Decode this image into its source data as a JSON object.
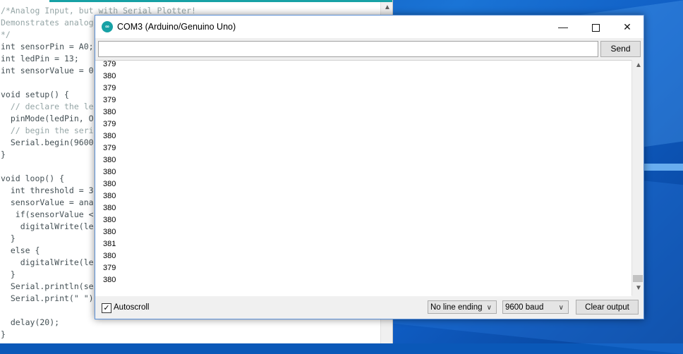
{
  "editor": {
    "code_lines": [
      "/*Analog Input, but with Serial Plotter!",
      "Demonstrates analog",
      "*/",
      "int sensorPin = A0;",
      "int ledPin = 13;",
      "int sensorValue = 0",
      "",
      "void setup() {",
      "  // declare the le",
      "  pinMode(ledPin, O",
      "  // begin the seri",
      "  Serial.begin(9600",
      "}",
      "",
      "void loop() {",
      "  int threshold = 3",
      "  sensorValue = ana",
      "   if(sensorValue <",
      "    digitalWrite(le",
      "  }",
      "  else {",
      "    digitalWrite(le",
      "  }",
      "  Serial.println(se",
      "  Serial.print(\" \")",
      "",
      "  delay(20);",
      "}"
    ]
  },
  "serial_monitor": {
    "title": "COM3 (Arduino/Genuino Uno)",
    "input_value": "",
    "send_label": "Send",
    "output_lines": [
      "379",
      "380",
      "379",
      "379",
      "380",
      "379",
      "380",
      "379",
      "380",
      "380",
      "380",
      "380",
      "380",
      "380",
      "380",
      "381",
      "380",
      "379",
      "380"
    ],
    "autoscroll_label": "Autoscroll",
    "autoscroll_checked": true,
    "line_ending": "No line ending",
    "baud_rate": "9600 baud",
    "clear_label": "Clear output"
  },
  "colors": {
    "arduino_teal": "#17a1a5",
    "desktop_blue": "#0a58b8"
  }
}
